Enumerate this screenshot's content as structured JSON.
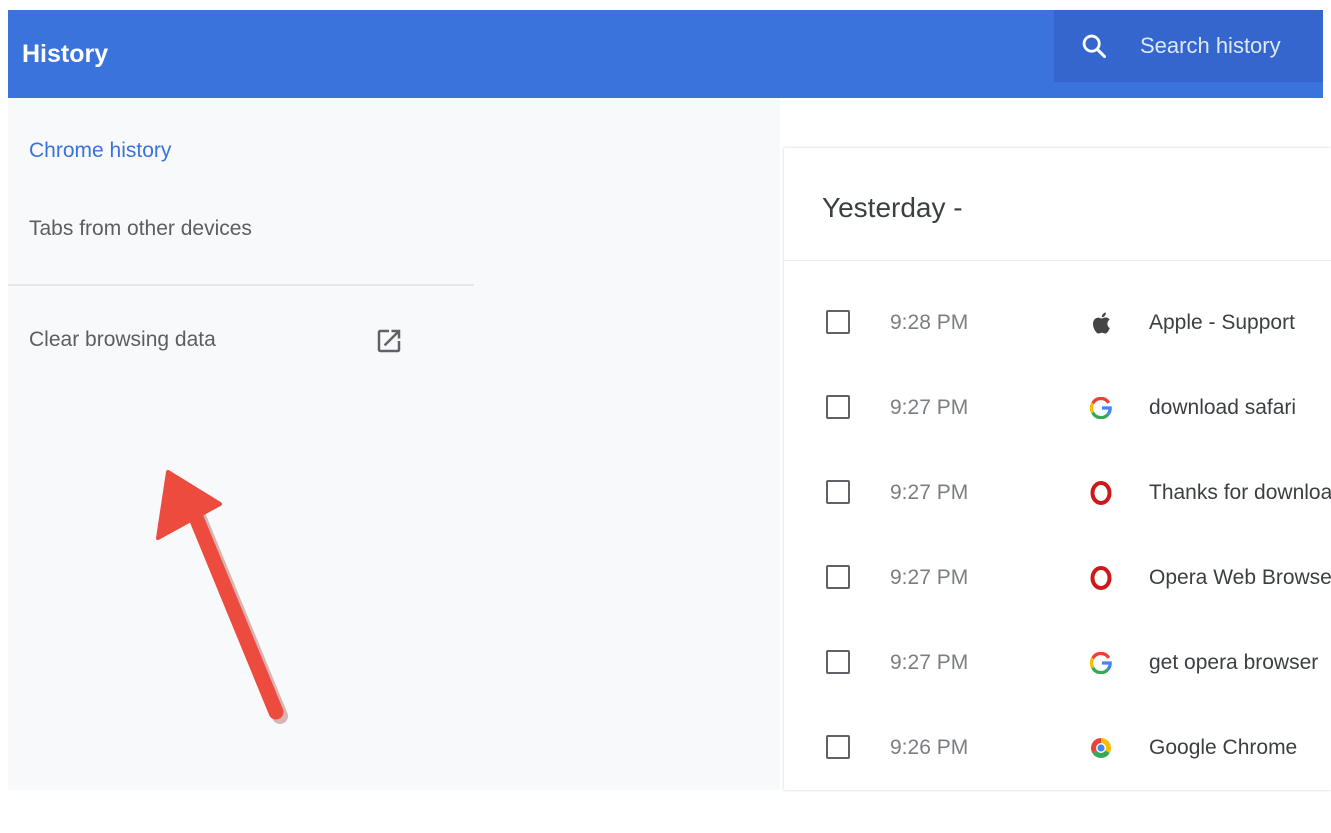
{
  "header": {
    "title": "History",
    "bg_color": "#3b73dc"
  },
  "search": {
    "placeholder": "Search history",
    "icon": "search-icon"
  },
  "sidebar": {
    "items": [
      {
        "label": "Chrome history",
        "active": true
      },
      {
        "label": "Tabs from other devices",
        "active": false
      }
    ],
    "clear_data": {
      "label": "Clear browsing data",
      "icon": "open-in-new-icon"
    }
  },
  "history": {
    "group_title": "Yesterday -",
    "entries": [
      {
        "time": "9:28 PM",
        "favicon": "apple-icon",
        "title": "Apple - Support"
      },
      {
        "time": "9:27 PM",
        "favicon": "google-icon",
        "title": "download safari"
      },
      {
        "time": "9:27 PM",
        "favicon": "opera-icon",
        "title": "Thanks for downloading"
      },
      {
        "time": "9:27 PM",
        "favicon": "opera-icon",
        "title": "Opera Web Browser"
      },
      {
        "time": "9:27 PM",
        "favicon": "google-icon",
        "title": "get opera browser"
      },
      {
        "time": "9:26 PM",
        "favicon": "chrome-icon",
        "title": "Google Chrome"
      }
    ]
  },
  "colors": {
    "accent": "#3b73dc",
    "arrow": "#ee4b3f"
  }
}
